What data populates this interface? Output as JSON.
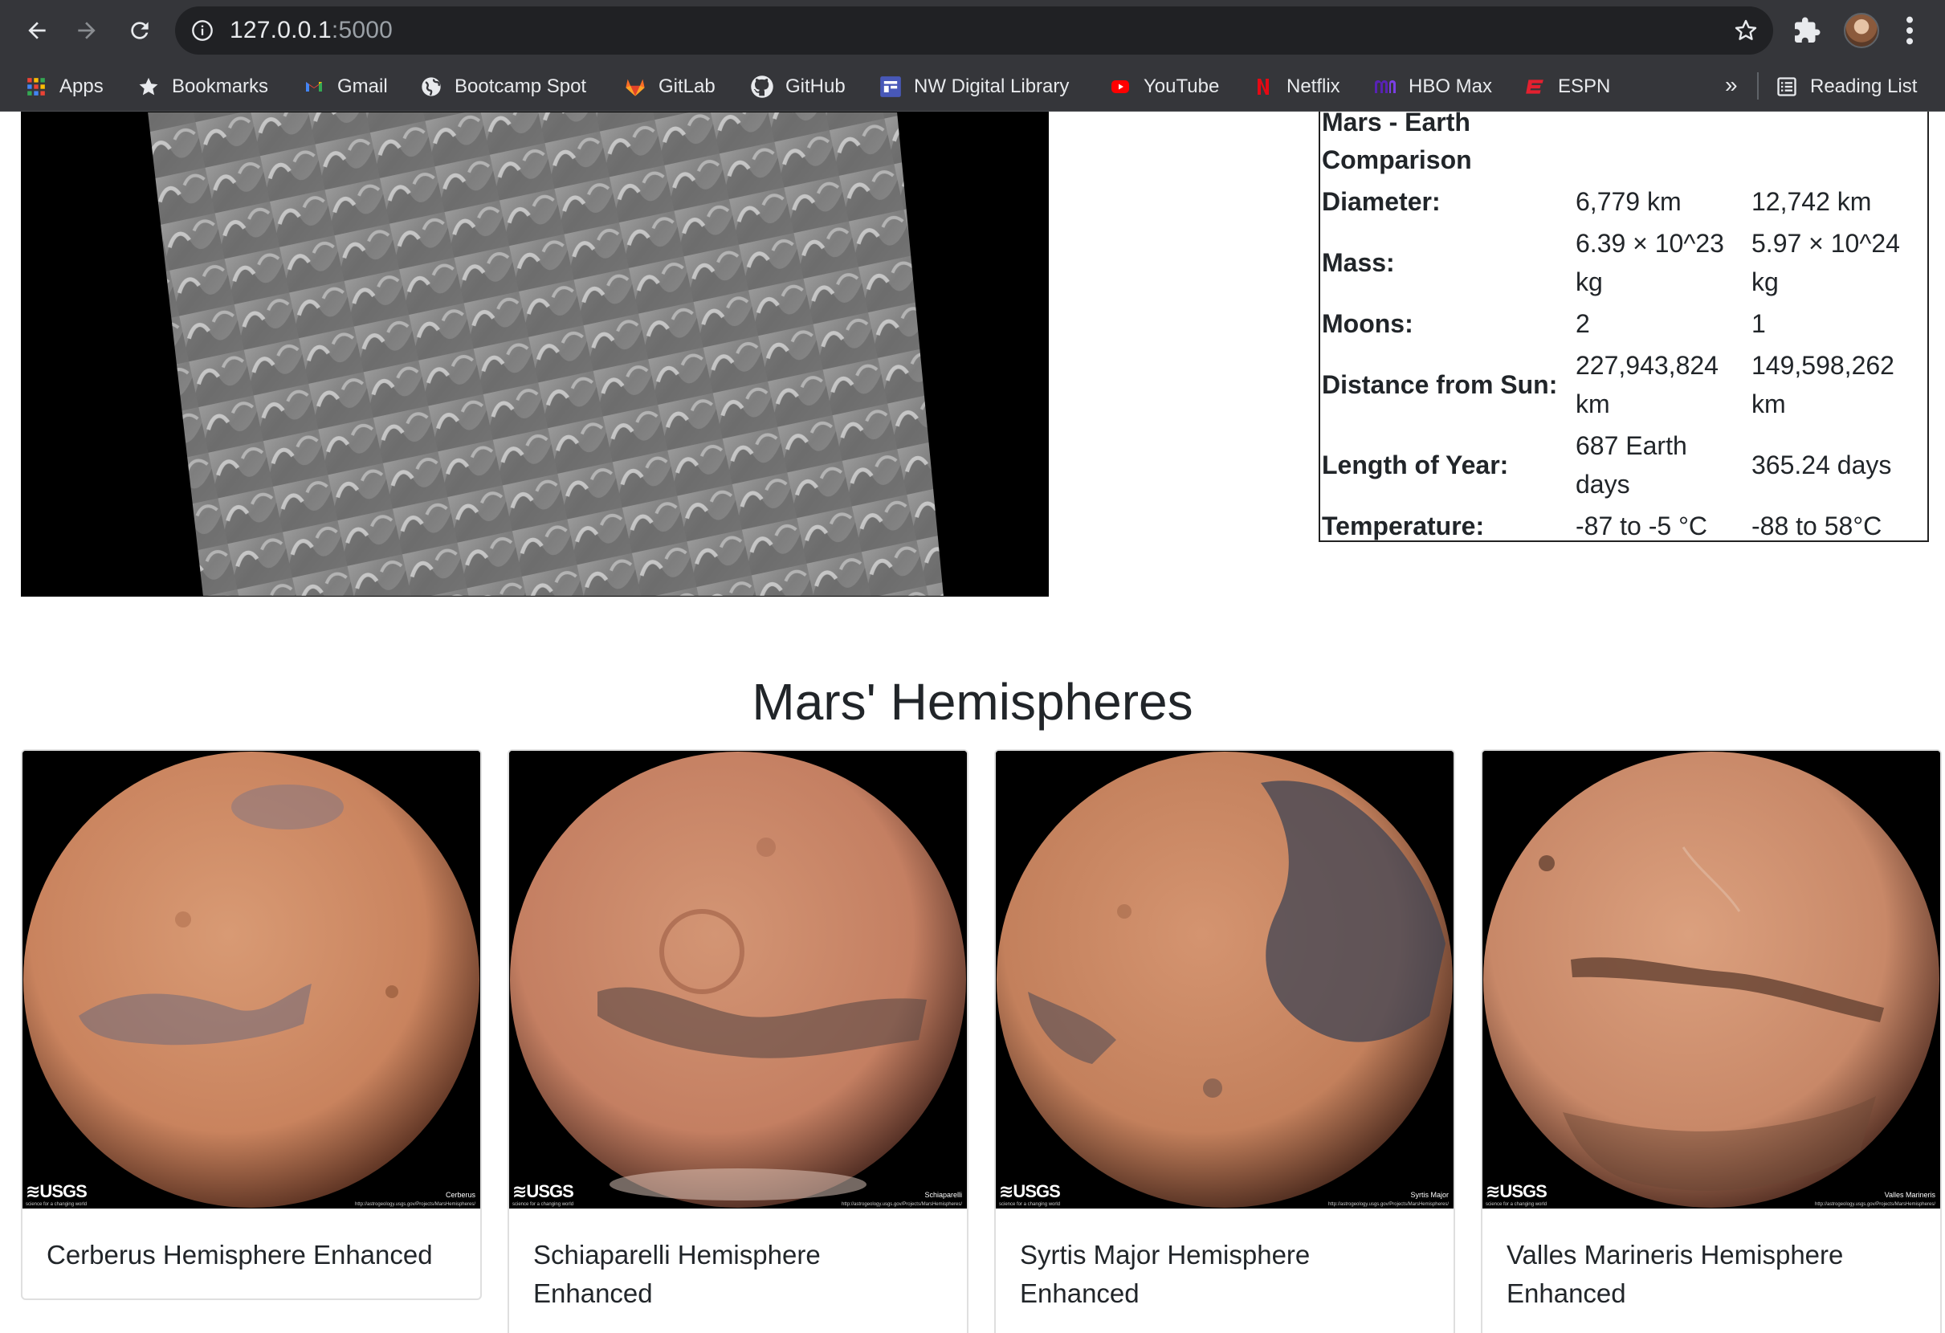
{
  "browser": {
    "url_host": "127.0.0.1",
    "url_port": ":5000",
    "bookmarks": [
      {
        "label": "Apps",
        "icon": "apps-grid-icon"
      },
      {
        "label": "Bookmarks",
        "icon": "star-icon"
      },
      {
        "label": "Gmail",
        "icon": "gmail-icon"
      },
      {
        "label": "Bootcamp Spot",
        "icon": "globe-icon"
      },
      {
        "label": "GitLab",
        "icon": "gitlab-icon"
      },
      {
        "label": "GitHub",
        "icon": "github-icon"
      },
      {
        "label": "NW Digital Library",
        "icon": "library-icon"
      },
      {
        "label": "YouTube",
        "icon": "youtube-icon"
      },
      {
        "label": "Netflix",
        "icon": "netflix-icon"
      },
      {
        "label": "HBO Max",
        "icon": "hbo-max-icon"
      },
      {
        "label": "ESPN",
        "icon": "espn-icon"
      }
    ],
    "more_label": "»",
    "reading_list": "Reading List"
  },
  "facts": {
    "caption_line1": "Mars - Earth",
    "caption_line2": "Comparison",
    "rows": [
      {
        "label": "Diameter:",
        "mars": "6,779 km",
        "earth": "12,742 km"
      },
      {
        "label": "Mass:",
        "mars": "6.39 × 10^23 kg",
        "earth": "5.97 × 10^24 kg"
      },
      {
        "label": "Moons:",
        "mars": "2",
        "earth": "1"
      },
      {
        "label": "Distance from Sun:",
        "mars": "227,943,824 km",
        "earth": "149,598,262 km"
      },
      {
        "label": "Length of Year:",
        "mars": "687 Earth days",
        "earth": "365.24 days"
      },
      {
        "label": "Temperature:",
        "mars": "-87 to -5 °C",
        "earth": "-88 to 58°C"
      }
    ]
  },
  "hemispheres": {
    "title": "Mars' Hemispheres",
    "items": [
      {
        "title": "Cerberus Hemisphere Enhanced",
        "tag": "Cerberus",
        "base": "#c9835e",
        "dark": "#6f6a7a"
      },
      {
        "title": "Schiaparelli Hemisphere Enhanced",
        "tag": "Schiaparelli",
        "base": "#c47f62",
        "dark": "#5c4a46"
      },
      {
        "title": "Syrtis Major Hemisphere Enhanced",
        "tag": "Syrtis Major",
        "base": "#c3805c",
        "dark": "#3f4454"
      },
      {
        "title": "Valles Marineris Hemisphere Enhanced",
        "tag": "Valles Marineris",
        "base": "#c88868",
        "dark": "#6b4636"
      }
    ],
    "usgs_label": "≋USGS",
    "usgs_sub": "science for a changing world",
    "image_url_text": "http://astrogeology.usgs.gov/Projects/MarsHemispheres/"
  }
}
